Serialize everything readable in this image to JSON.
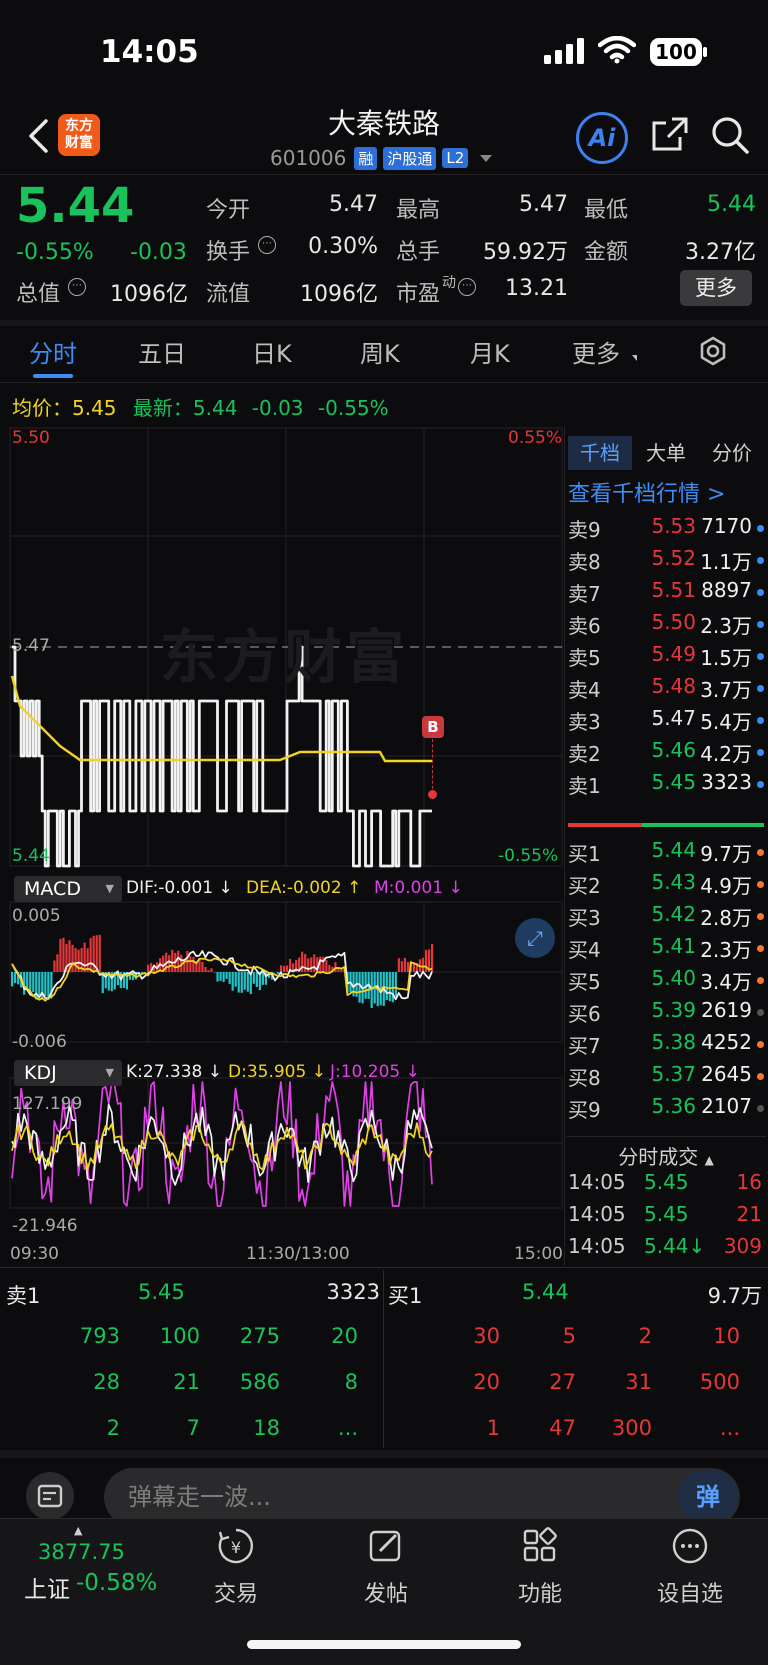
{
  "status": {
    "time": "14:05",
    "battery": "100"
  },
  "header": {
    "logo_line1": "东方",
    "logo_line2": "财富",
    "stock_name": "大秦铁路",
    "code": "601006",
    "tags": [
      "融",
      "沪股通",
      "L2"
    ],
    "ai_label": "Ai"
  },
  "quote": {
    "price": "5.44",
    "change_pct": "-0.55%",
    "change": "-0.03",
    "row1": [
      {
        "label": "今开",
        "value": "5.47",
        "color": "#e8e8e8"
      },
      {
        "label": "最高",
        "value": "5.47",
        "color": "#e8e8e8"
      },
      {
        "label": "最低",
        "value": "5.44",
        "color": "#19c25a"
      }
    ],
    "row2": [
      {
        "label": "换手",
        "value": "0.30%",
        "color": "#e8e8e8"
      },
      {
        "label": "总手",
        "value": "59.92万",
        "color": "#e8e8e8"
      },
      {
        "label": "金额",
        "value": "3.27亿",
        "color": "#e8e8e8"
      }
    ],
    "row3": [
      {
        "label": "总值",
        "value": "1096亿"
      },
      {
        "label": "流值",
        "value": "1096亿"
      },
      {
        "label": "市盈",
        "sup": "动",
        "value": "13.21"
      }
    ],
    "more_label": "更多"
  },
  "tabs": [
    "分时",
    "五日",
    "日K",
    "周K",
    "月K",
    "更多"
  ],
  "intraday": {
    "avg_label": "均价：",
    "avg_value": "5.45",
    "latest_label": "最新：",
    "latest_value": "5.44",
    "latest_change": "-0.03",
    "latest_pct": "-0.55%",
    "y_top": "5.50",
    "y_top_pct": "0.55%",
    "y_mid": "5.47",
    "y_bottom": "5.44",
    "y_bottom_pct": "-0.55%",
    "watermark": "东方财富",
    "marker": "B",
    "x_labels": [
      "09:30",
      "11:30/13:00",
      "15:00"
    ]
  },
  "macd": {
    "name": "MACD",
    "dif": "DIF:-0.001 ↓",
    "dea": "DEA:-0.002 ↑",
    "m": "M:0.001 ↓",
    "y_top": "0.005",
    "y_bottom": "-0.006"
  },
  "kdj": {
    "name": "KDJ",
    "k": "K:27.338 ↓",
    "d": "D:35.905 ↓",
    "j": "J:10.205 ↓",
    "y_top": "127.199",
    "y_bottom": "-21.946"
  },
  "orderbook": {
    "tabs": [
      "千档",
      "大单",
      "分价"
    ],
    "link": "查看千档行情 >",
    "asks": [
      {
        "label": "卖9",
        "price": "5.53",
        "vol": "7170",
        "pc": "#e5363a",
        "dot": "#3f8cf2"
      },
      {
        "label": "卖8",
        "price": "5.52",
        "vol": "1.1万",
        "pc": "#e5363a",
        "dot": "#3f8cf2"
      },
      {
        "label": "卖7",
        "price": "5.51",
        "vol": "8897",
        "pc": "#e5363a",
        "dot": "#3f8cf2"
      },
      {
        "label": "卖6",
        "price": "5.50",
        "vol": "2.3万",
        "pc": "#e5363a",
        "dot": "#3f8cf2"
      },
      {
        "label": "卖5",
        "price": "5.49",
        "vol": "1.5万",
        "pc": "#e5363a",
        "dot": "#3f8cf2"
      },
      {
        "label": "卖4",
        "price": "5.48",
        "vol": "3.7万",
        "pc": "#e5363a",
        "dot": "#3f8cf2"
      },
      {
        "label": "卖3",
        "price": "5.47",
        "vol": "5.4万",
        "pc": "#e8e8e8",
        "dot": "#3f8cf2"
      },
      {
        "label": "卖2",
        "price": "5.46",
        "vol": "4.2万",
        "pc": "#19c25a",
        "dot": "#3f8cf2"
      },
      {
        "label": "卖1",
        "price": "5.45",
        "vol": "3323",
        "pc": "#19c25a",
        "dot": "#3f8cf2"
      }
    ],
    "bids": [
      {
        "label": "买1",
        "price": "5.44",
        "vol": "9.7万",
        "pc": "#19c25a",
        "dot": "#f07a2a"
      },
      {
        "label": "买2",
        "price": "5.43",
        "vol": "4.9万",
        "pc": "#19c25a",
        "dot": "#f07a2a"
      },
      {
        "label": "买3",
        "price": "5.42",
        "vol": "2.8万",
        "pc": "#19c25a",
        "dot": "#f07a2a"
      },
      {
        "label": "买4",
        "price": "5.41",
        "vol": "2.3万",
        "pc": "#19c25a",
        "dot": "#f07a2a"
      },
      {
        "label": "买5",
        "price": "5.40",
        "vol": "3.4万",
        "pc": "#19c25a",
        "dot": "#f07a2a"
      },
      {
        "label": "买6",
        "price": "5.39",
        "vol": "2619",
        "pc": "#19c25a",
        "dot": "#555555"
      },
      {
        "label": "买7",
        "price": "5.38",
        "vol": "4252",
        "pc": "#19c25a",
        "dot": "#f07a2a"
      },
      {
        "label": "买8",
        "price": "5.37",
        "vol": "2645",
        "pc": "#19c25a",
        "dot": "#f07a2a"
      },
      {
        "label": "买9",
        "price": "5.36",
        "vol": "2107",
        "pc": "#19c25a",
        "dot": "#555555"
      }
    ],
    "ticks_title": "分时成交",
    "ticks": [
      {
        "time": "14:05",
        "price": "5.45",
        "vol": "16"
      },
      {
        "time": "14:05",
        "price": "5.45",
        "vol": "21"
      },
      {
        "time": "14:05",
        "price": "5.44↓",
        "vol": "309"
      }
    ]
  },
  "book_bottom": {
    "ask_label": "卖1",
    "ask_price": "5.45",
    "ask_vol": "3323",
    "bid_label": "买1",
    "bid_price": "5.44",
    "bid_vol": "9.7万",
    "ask_grid": [
      [
        "793",
        "100",
        "275",
        "20"
      ],
      [
        "28",
        "21",
        "586",
        "8"
      ],
      [
        "2",
        "7",
        "18",
        "..."
      ]
    ],
    "bid_grid": [
      [
        "30",
        "5",
        "2",
        "10"
      ],
      [
        "20",
        "27",
        "31",
        "500"
      ],
      [
        "1",
        "47",
        "300",
        "..."
      ]
    ]
  },
  "danmu": {
    "placeholder": "弹幕走一波...",
    "button": "弹"
  },
  "tabbar": {
    "index_value": "3877.75",
    "index_name": "上证",
    "index_pct": "-0.58%",
    "items": [
      "交易",
      "发帖",
      "功能",
      "设自选"
    ]
  }
}
